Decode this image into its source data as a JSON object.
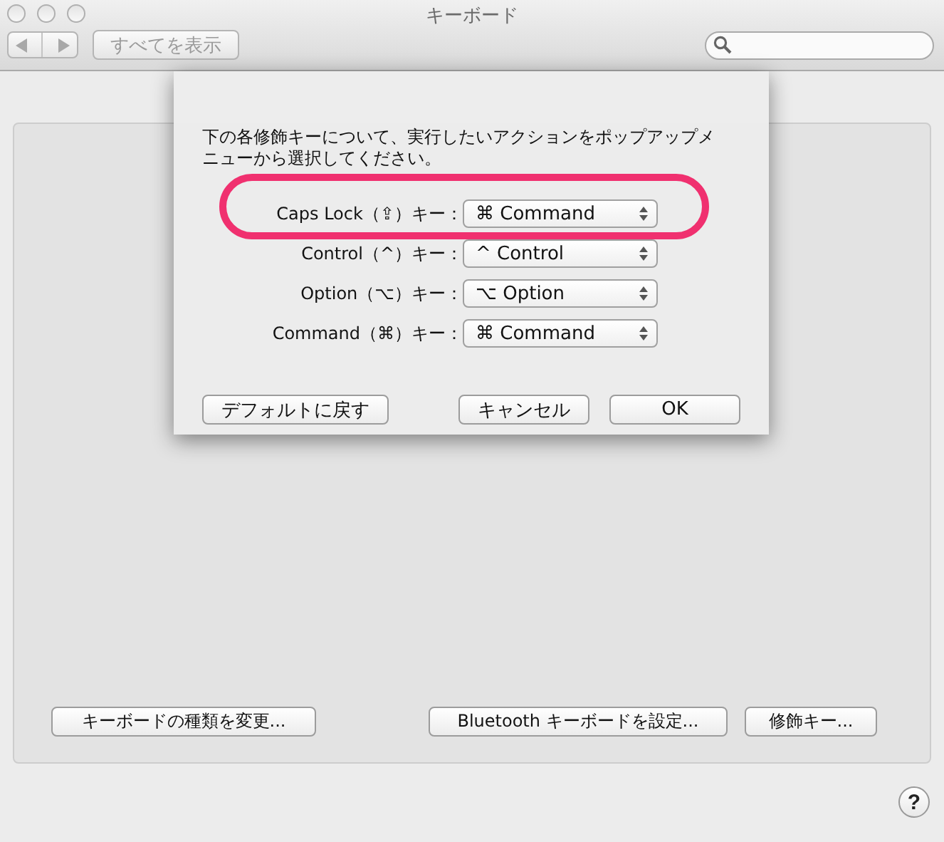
{
  "window": {
    "title": "キーボード"
  },
  "toolbar": {
    "show_all": "すべてを表示"
  },
  "panel_buttons": [
    "キーボードの種類を変更...",
    "Bluetooth キーボードを設定...",
    "修飾キー..."
  ],
  "help": "?",
  "sheet": {
    "message": "下の各修飾キーについて、実行したいアクションをポップアップメニューから選択してください。",
    "rows": [
      {
        "label": "Caps Lock（⇪）キー：",
        "value": "⌘ Command",
        "highlighted": true
      },
      {
        "label": "Control（^）キー：",
        "value": "^ Control",
        "highlighted": false
      },
      {
        "label": "Option（⌥）キー：",
        "value": "⌥ Option",
        "highlighted": false
      },
      {
        "label": "Command（⌘）キー：",
        "value": "⌘ Command",
        "highlighted": false
      }
    ],
    "default_button": "デフォルトに戻す",
    "cancel_button": "キャンセル",
    "ok_button": "OK"
  }
}
